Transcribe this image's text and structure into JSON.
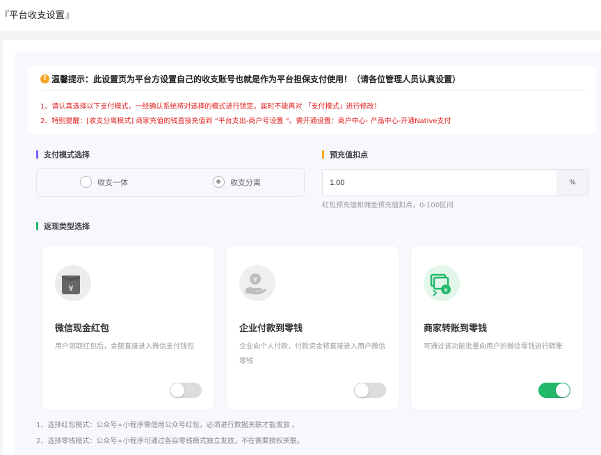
{
  "page": {
    "title": "『平台收支设置』"
  },
  "notice": {
    "icon": "warning-icon",
    "title": "温馨提示：此设置页为平台方设置自己的收支账号也就是作为平台担保支付使用！（请各位管理人员认真设置）",
    "line1": "1、请认真选择以下支付模式，一经确认系统将对选择的模式进行锁定。届时不能再对 「支付模式」进行修改！",
    "line2": "2、特别提醒：[收支分离模式] 商家充值的钱直接充值到 “平台支出-商户号设置 ”。需开通设置：商户中心- 产品中心-开通Native支付"
  },
  "payment_mode": {
    "label": "支付模式选择",
    "bar_color": "#7b61ff",
    "options": [
      {
        "label": "收支一体",
        "checked": false
      },
      {
        "label": "收支分离",
        "checked": true
      }
    ]
  },
  "prepay": {
    "label": "预充值扣点",
    "bar_color": "#f5a623",
    "value": "1.00",
    "unit": "%",
    "hint": "红包预充值和佣金预充值扣点，0-100区间"
  },
  "cashback": {
    "label": "返现类型选择",
    "bar_color": "#21b86a",
    "cards": [
      {
        "title": "微信现金红包",
        "desc": "用户领取红包后，金额直接进入微信支付钱包",
        "icon": "red-envelope-icon",
        "enabled": false
      },
      {
        "title": "企业付款到零钱",
        "desc": "企业向个人付款，付款资金将直接进入用户微信零钱",
        "icon": "coin-hand-icon",
        "enabled": false
      },
      {
        "title": "商家转账到零钱",
        "desc": "可通过该功能批量向用户的微信零钱进行转账",
        "icon": "transfer-icon",
        "enabled": true
      }
    ]
  },
  "footnotes": [
    "1、选择红包模式：公众号+小程序需借用公众号红包，必须进行数据关联才能发放 。",
    "2、选择零钱模式：公众号+小程序可通过各自零钱模式独立发放，不在需要授权关联。"
  ],
  "colors": {
    "accent_green": "#21b86a",
    "warning_red": "#e02020",
    "warning_yellow": "#f5a623"
  }
}
